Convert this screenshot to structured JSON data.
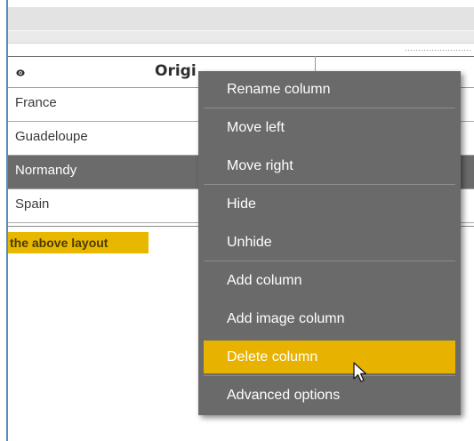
{
  "grid": {
    "header_title": "Origi",
    "rows": [
      {
        "label": "France"
      },
      {
        "label": "Guadeloupe"
      },
      {
        "label": "Normandy",
        "selected": true
      },
      {
        "label": "Spain"
      }
    ]
  },
  "footer": {
    "label": "the above layout"
  },
  "context_menu": {
    "items": [
      {
        "label": "Rename column"
      },
      {
        "label": "Move left"
      },
      {
        "label": "Move right"
      },
      {
        "label": "Hide"
      },
      {
        "label": "Unhide"
      },
      {
        "label": "Add column"
      },
      {
        "label": "Add image column"
      },
      {
        "label": "Delete column",
        "highlighted": true
      },
      {
        "label": "Advanced options"
      }
    ]
  },
  "colors": {
    "selected_row": "#6b6b6b",
    "menu_background": "#6a6a6a",
    "highlight": "#e8b300",
    "footer_label_bg": "#e8b800"
  },
  "icons": {
    "header_icon": "eye-icon",
    "cursor": "mouse-pointer-icon"
  }
}
